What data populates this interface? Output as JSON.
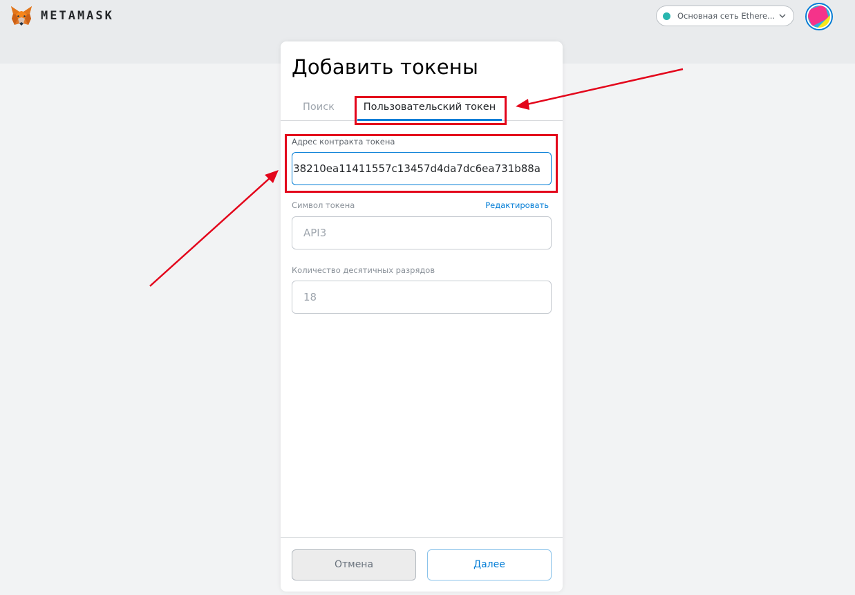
{
  "header": {
    "brand_name": "METAMASK",
    "logo_icon": "metamask-fox-icon",
    "network": {
      "label": "Основная сеть Ethere...",
      "status_color": "#29b6af"
    },
    "avatar_icon": "account-avatar"
  },
  "page": {
    "title": "Добавить токены",
    "tabs": [
      {
        "label": "Поиск",
        "active": false
      },
      {
        "label": "Пользовательский токен",
        "active": true
      }
    ],
    "fields": {
      "address": {
        "label": "Адрес контракта токена",
        "value": "38210ea11411557c13457d4da7dc6ea731b88a"
      },
      "symbol": {
        "label": "Символ токена",
        "value": "API3",
        "edit_link": "Редактировать"
      },
      "decimals": {
        "label": "Количество десятичных разрядов",
        "value": "18"
      }
    },
    "buttons": {
      "cancel": "Отмена",
      "next": "Далее"
    }
  },
  "colors": {
    "accent": "#037dd6",
    "annotation": "#e3051b",
    "header_band": "#e9ebed",
    "page_background": "#f2f3f4"
  }
}
